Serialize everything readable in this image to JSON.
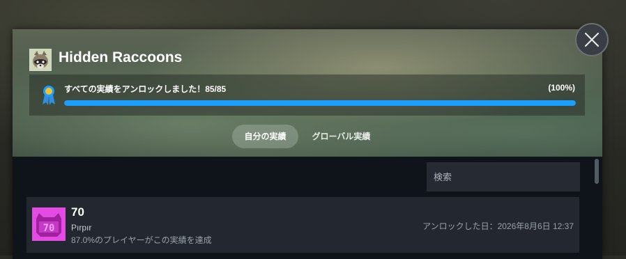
{
  "game": {
    "title": "Hidden Raccoons",
    "icon": "raccoon-icon"
  },
  "progress": {
    "text": "すべての実績をアンロックしました！85/85",
    "percent_label": "(100%)",
    "unlocked": 85,
    "total": 85,
    "fraction": 1.0,
    "icon": "ribbon-medal-icon",
    "bar_color": "#1a9fff"
  },
  "tabs": [
    {
      "label": "自分の実績",
      "active": true
    },
    {
      "label": "グローバル実績",
      "active": false
    }
  ],
  "search": {
    "placeholder": "検索",
    "value": ""
  },
  "achievements": [
    {
      "icon_text": "70",
      "icon_color": "#e34ce3",
      "title": "70",
      "description": "Pırpır",
      "global_percent": "87.0%のプレイヤーがこの実績を達成",
      "unlocked_at": "アンロックした日：2026年8月6日 12:37"
    }
  ],
  "close_icon": "close-icon"
}
